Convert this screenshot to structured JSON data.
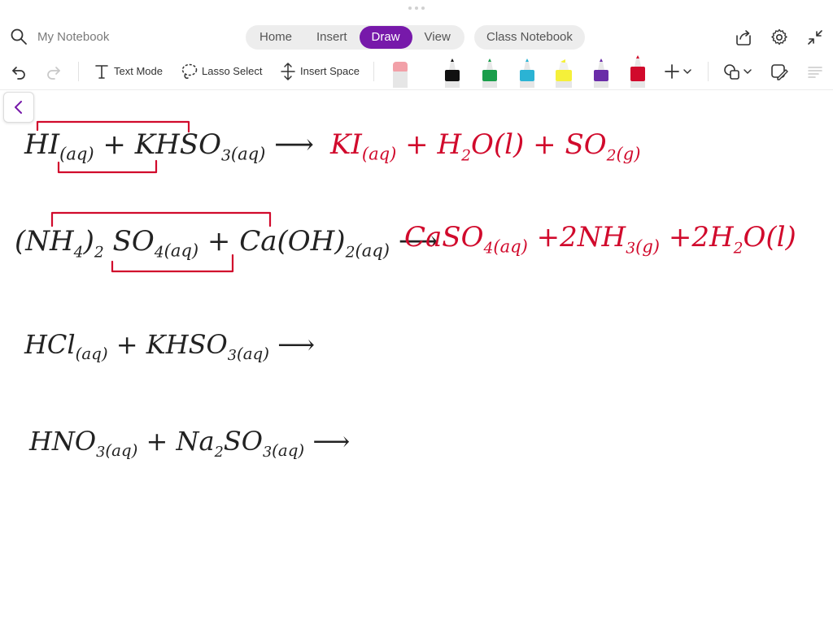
{
  "header": {
    "notebook_name": "My Notebook",
    "tabs": [
      {
        "label": "Home",
        "active": false
      },
      {
        "label": "Insert",
        "active": false
      },
      {
        "label": "Draw",
        "active": true
      },
      {
        "label": "View",
        "active": false
      }
    ],
    "class_notebook_label": "Class Notebook",
    "accent_color": "#7719aa"
  },
  "toolbar": {
    "text_mode_label": "Text Mode",
    "lasso_select_label": "Lasso Select",
    "insert_space_label": "Insert Space",
    "pens": [
      {
        "name": "eraser",
        "color": "#f2a0a8"
      },
      {
        "name": "black-pen",
        "color": "#111111"
      },
      {
        "name": "green-pen",
        "color": "#1a9e4b"
      },
      {
        "name": "teal-pen",
        "color": "#2bb3d4"
      },
      {
        "name": "yellow-highlighter",
        "color": "#f5f03a"
      },
      {
        "name": "purple-pen",
        "color": "#6a2ca8"
      },
      {
        "name": "red-pen",
        "color": "#d10a2c"
      }
    ]
  },
  "canvas": {
    "ink_color_black": "#222222",
    "ink_color_red": "#d10a2c",
    "eq1": {
      "reactant_a": "HI",
      "reactant_a_state": "(aq)",
      "plus": "+",
      "reactant_b_main": "KHSO",
      "reactant_b_sub": "3",
      "reactant_b_state": "(aq)",
      "arrow": "⟶",
      "p1": "KI",
      "p1_state": "(aq)",
      "p2_a": "H",
      "p2_sub": "2",
      "p2_b": "O(l)",
      "p3": "SO",
      "p3_sub": "2",
      "p3_state": "(g)"
    },
    "eq2": {
      "r1_a": "(NH",
      "r1_sub1": "4",
      "r1_b": ")",
      "r1_sub2": "2",
      "r1_c": "SO",
      "r1_sub3": "4",
      "r1_state": "(aq)",
      "plus": "+",
      "r2_a": "Ca(OH)",
      "r2_sub": "2",
      "r2_state": "(aq)",
      "arrow": "⟶",
      "p1_a": "CaSO",
      "p1_sub": "4",
      "p1_state": "(aq)",
      "p2_a": "+2NH",
      "p2_sub": "3",
      "p2_state": "(g)",
      "p3_a": "+2H",
      "p3_sub": "2",
      "p3_b": "O(l)"
    },
    "eq3": {
      "r1": "HCl",
      "r1_state": "(aq)",
      "plus": "+",
      "r2_a": "KHSO",
      "r2_sub": "3",
      "r2_state": "(aq)",
      "arrow": "⟶"
    },
    "eq4": {
      "r1_a": "HNO",
      "r1_sub": "3",
      "r1_state": "(aq)",
      "plus": "+",
      "r2_a": "Na",
      "r2_sub1": "2",
      "r2_b": "SO",
      "r2_sub2": "3",
      "r2_state": "(aq)",
      "arrow": "⟶"
    }
  }
}
